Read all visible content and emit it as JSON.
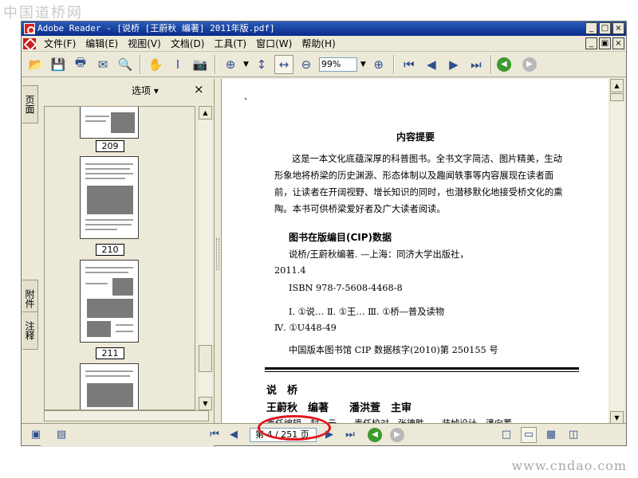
{
  "watermark_top": "中国道桥网",
  "watermark_bottom": "www.cndao.com",
  "window": {
    "title": "Adobe Reader - [说桥 [王蔚秋 编著] 2011年版.pdf]"
  },
  "menu": [
    "文件(F)",
    "编辑(E)",
    "视图(V)",
    "文档(D)",
    "工具(T)",
    "窗口(W)",
    "帮助(H)"
  ],
  "toolbar": {
    "icons": [
      "open-icon",
      "save-icon",
      "print-icon",
      "email-icon",
      "search-icon",
      "hand-tool-icon",
      "select-text-icon",
      "snapshot-icon",
      "zoom-in-icon",
      "actual-size-icon",
      "fit-width-icon",
      "zoom-out-icon",
      "zoom-plus-icon",
      "first-page-icon",
      "prev-page-icon",
      "next-page-icon",
      "last-page-icon",
      "back-icon",
      "forward-icon"
    ],
    "zoom_value": "99%"
  },
  "side_tabs": [
    "页面",
    "附件",
    "注释"
  ],
  "pages_panel": {
    "options_label": "选项 ▾",
    "close_label": "×",
    "thumbnails": [
      "209",
      "210",
      "211"
    ]
  },
  "document": {
    "mark": "、",
    "title": "内容提要",
    "summary": "这是一本文化底蕴深厚的科普图书。全书文字简洁、图片精美，生动形象地将桥梁的历史渊源、形态体制以及趣闻轶事等内容展现在读者面前，让读者在开阔视野、增长知识的同时，也潜移默化地接受桥文化的熏陶。本书可供桥梁爱好者及广大读者阅读。",
    "cip_heading": "图书在版编目(CIP)数据",
    "cip_line1": "说桥/王蔚秋编著. —上海：同济大学出版社，",
    "cip_line2": "2011.4",
    "isbn": "ISBN 978-7-5608-4468-8",
    "class_line1": "Ⅰ. ①说…  Ⅱ. ①王…  Ⅲ. ①桥—普及读物",
    "class_line2": "Ⅳ. ①U448-49",
    "cip_number": "中国版本图书馆 CIP 数据核字(2010)第 250155 号",
    "book_title": "说　桥",
    "book_authors": "王蔚秋　编著　　潘洪萱　主审",
    "book_editors": "责任编辑　封　云　　责任校对　张德胜　　装帧设计　潘向蓁"
  },
  "status": {
    "page_display": "第 4 / 251 页"
  }
}
